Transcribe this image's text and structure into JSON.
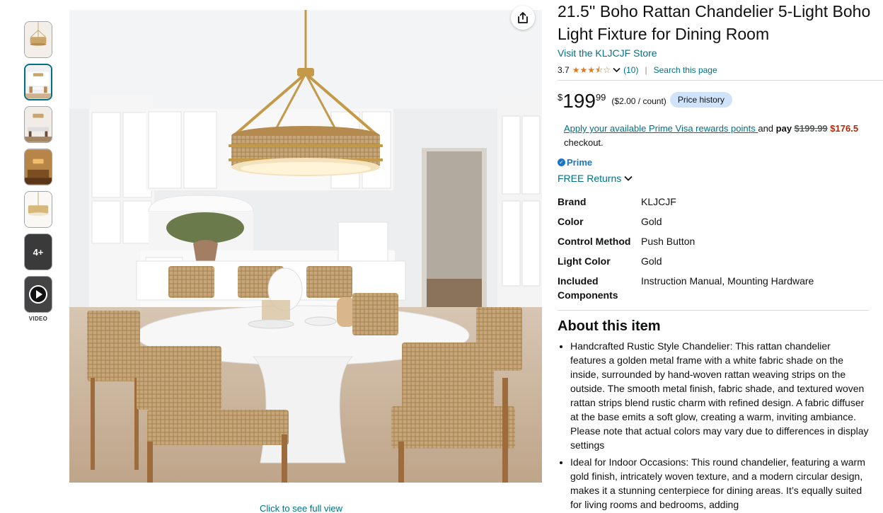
{
  "thumbnails": {
    "more_label": "4+",
    "video_label": "VIDEO"
  },
  "gallery": {
    "click_full_view": "Click to see full view"
  },
  "product": {
    "title": "21.5'' Boho Rattan Chandelier 5-Light Boho Light Fixture for Dining Room",
    "store_link": "Visit the KLJCJF Store",
    "rating": "3.7",
    "rating_stars": 3.7,
    "rating_count": "(10)",
    "search_page": "Search this page"
  },
  "price": {
    "symbol": "$",
    "whole": "199",
    "fraction": "99",
    "unit": "($2.00 / count)",
    "history_button": "Price history"
  },
  "promo": {
    "link_text": "Apply your available Prime Visa rewards points ",
    "and_text": "and ",
    "pay_text": "pay ",
    "old_price": "$199.99",
    "new_price": "$176.5",
    "checkout": "checkout."
  },
  "prime": {
    "label": "Prime"
  },
  "returns": {
    "label": "FREE Returns"
  },
  "specs": [
    {
      "key": "Brand",
      "value": "KLJCJF"
    },
    {
      "key": "Color",
      "value": "Gold"
    },
    {
      "key": "Control Method",
      "value": "Push Button"
    },
    {
      "key": "Light Color",
      "value": "Gold"
    },
    {
      "key": "Included Components",
      "value": "Instruction Manual, Mounting Hardware"
    }
  ],
  "about": {
    "title": "About this item",
    "bullets": [
      "Handcrafted Rustic Style Chandelier: This rattan chandelier features a golden metal frame with a white fabric shade on the inside, surrounded by hand-woven rattan weaving strips on the outside. The smooth metal finish, fabric shade, and textured woven rattan strips blend rustic charm with refined design. A fabric diffuser at the base emits a soft glow, creating a warm, inviting ambiance. Please note that actual colors may vary due to differences in display settings",
      "Ideal for Indoor Occasions: This round chandelier, featuring a warm gold finish, intricately woven texture, and a modern circular design, makes it a stunning centerpiece for dining areas. It’s equally suited for living rooms and bedrooms, adding"
    ]
  },
  "colors": {
    "link": "#007185",
    "prime_blue": "#1a75c9",
    "star": "#de7921",
    "deal_red": "#b12704",
    "price_history_bg": "#cfe4fb"
  }
}
